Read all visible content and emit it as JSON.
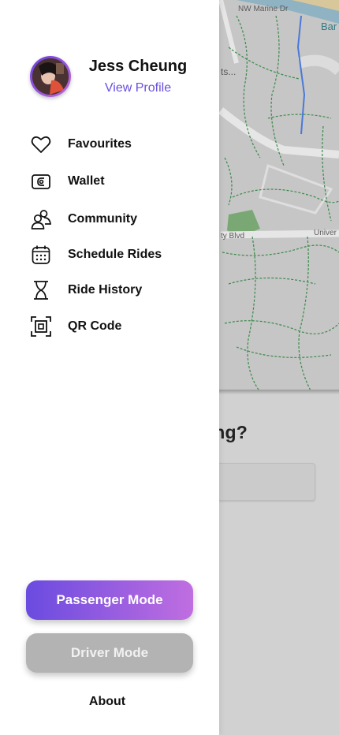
{
  "map": {
    "labels": {
      "marine": "NW Marine Dr",
      "ban": "Bar",
      "ts": "ts...",
      "blvd": "ty Blvd",
      "univ": "Univer"
    }
  },
  "background": {
    "question_fragment": "ng?"
  },
  "profile": {
    "name": "Jess Cheung",
    "view_profile": "View Profile"
  },
  "menu": [
    {
      "label": "Favourites",
      "icon": "heart-icon"
    },
    {
      "label": "Wallet",
      "icon": "wallet-icon"
    },
    {
      "label": "Community",
      "icon": "community-icon"
    },
    {
      "label": "Schedule Rides",
      "icon": "calendar-icon"
    },
    {
      "label": "Ride History",
      "icon": "hourglass-icon"
    },
    {
      "label": "QR Code",
      "icon": "qr-code-icon"
    }
  ],
  "buttons": {
    "passenger_mode": "Passenger Mode",
    "driver_mode": "Driver Mode",
    "about": "About"
  },
  "colors": {
    "accent": "#6a4ee0",
    "gradient_end": "#c06ee0",
    "driver_button": "#b3b3b3"
  }
}
